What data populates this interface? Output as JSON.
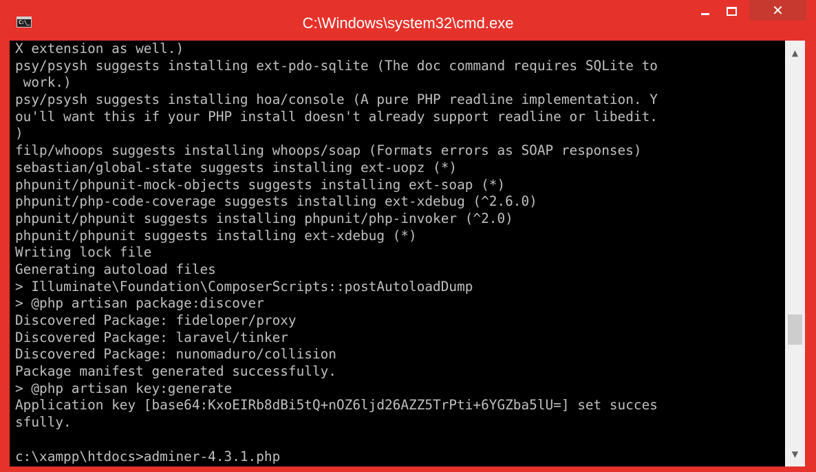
{
  "window": {
    "title": "C:\\Windows\\system32\\cmd.exe",
    "icon_name": "command-prompt-icon",
    "icon_glyph": "C:\\_",
    "controls": {
      "minimize_icon": "minimize-icon",
      "maximize_icon": "maximize-icon",
      "close_glyph": "✕"
    },
    "colors": {
      "frame": "#e5322b",
      "close_button": "#c7382e",
      "console_background": "#000000",
      "console_text": "#c0c0c0"
    }
  },
  "console": {
    "lines": [
      "X extension as well.)",
      "psy/psysh suggests installing ext-pdo-sqlite (The doc command requires SQLite to",
      " work.)",
      "psy/psysh suggests installing hoa/console (A pure PHP readline implementation. Y",
      "ou'll want this if your PHP install doesn't already support readline or libedit.",
      ")",
      "filp/whoops suggests installing whoops/soap (Formats errors as SOAP responses)",
      "sebastian/global-state suggests installing ext-uopz (*)",
      "phpunit/phpunit-mock-objects suggests installing ext-soap (*)",
      "phpunit/php-code-coverage suggests installing ext-xdebug (^2.6.0)",
      "phpunit/phpunit suggests installing phpunit/php-invoker (^2.0)",
      "phpunit/phpunit suggests installing ext-xdebug (*)",
      "Writing lock file",
      "Generating autoload files",
      "> Illuminate\\Foundation\\ComposerScripts::postAutoloadDump",
      "> @php artisan package:discover",
      "Discovered Package: fideloper/proxy",
      "Discovered Package: laravel/tinker",
      "Discovered Package: nunomaduro/collision",
      "Package manifest generated successfully.",
      "> @php artisan key:generate",
      "Application key [base64:KxoEIRb8dBi5tQ+nOZ6ljd26AZZ5TrPti+6YGZba5lU=] set succes",
      "sfully.",
      "",
      "c:\\xampp\\htdocs>adminer-4.3.1.php"
    ]
  },
  "scrollbar": {
    "up_arrow": "▲",
    "down_arrow": "▼",
    "up_icon": "scroll-up-arrow-icon",
    "down_icon": "scroll-down-arrow-icon"
  }
}
